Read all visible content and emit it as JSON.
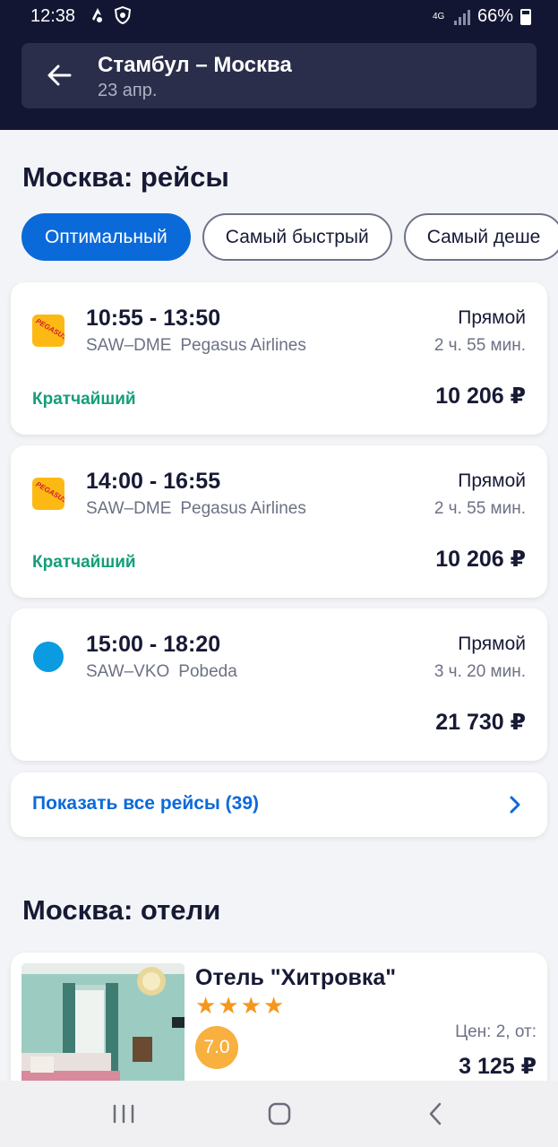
{
  "status_bar": {
    "time": "12:38",
    "network": "4G",
    "battery": "66%",
    "icons": [
      "notification-icon",
      "shield-icon",
      "signal-icon",
      "battery-icon"
    ]
  },
  "header": {
    "title": "Стамбул – Москва",
    "date": "23 апр.",
    "back_icon": "arrow-left-icon"
  },
  "flights": {
    "section_title": "Москва: рейсы",
    "filters": [
      {
        "label": "Оптимальный",
        "active": true
      },
      {
        "label": "Самый быстрый",
        "active": false
      },
      {
        "label": "Самый деше",
        "active": false
      }
    ],
    "items": [
      {
        "times": "10:55 - 13:50",
        "route": "SAW–DME",
        "airline": "Pegasus Airlines",
        "logo_text": "PEGASUS",
        "type": "Прямой",
        "duration": "2 ч. 55 мин.",
        "tag": "Кратчайший",
        "price": "10 206 ₽"
      },
      {
        "times": "14:00 - 16:55",
        "route": "SAW–DME",
        "airline": "Pegasus Airlines",
        "logo_text": "PEGASUS",
        "type": "Прямой",
        "duration": "2 ч. 55 мин.",
        "tag": "Кратчайший",
        "price": "10 206 ₽"
      },
      {
        "times": "15:00 - 18:20",
        "route": "SAW–VKO",
        "airline": "Pobeda",
        "type": "Прямой",
        "duration": "3 ч. 20 мин.",
        "tag": "",
        "price": "21 730 ₽"
      }
    ],
    "show_all": "Показать все рейсы (39)"
  },
  "hotels": {
    "section_title": "Москва: отели",
    "items": [
      {
        "name": "Отель \"Хитровка\"",
        "stars": 4,
        "rating": "7.0",
        "price_label": "Цен: 2, от:",
        "price": "3 125 ₽"
      }
    ]
  },
  "colors": {
    "header_bg": "#131633",
    "accent": "#0b6ad9",
    "tag_green": "#139e7a",
    "star": "#f7961d",
    "rating_bg": "#f8b03e",
    "pegasus_yellow": "#fdb913",
    "pobeda_blue": "#0b9be0"
  }
}
